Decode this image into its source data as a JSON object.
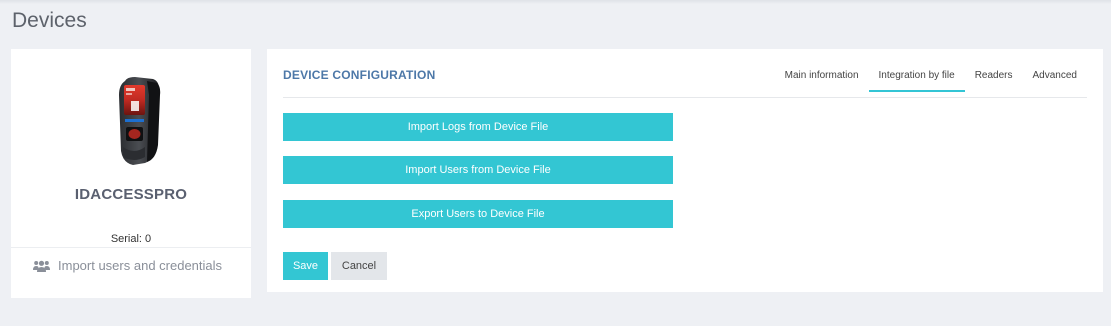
{
  "page": {
    "title": "Devices"
  },
  "device": {
    "name": "IDACCESSPRO",
    "serial": "Serial: 0",
    "import_link": "Import users and credentials",
    "image_icon": "fingerprint-terminal",
    "link_icon": "users-icon"
  },
  "config": {
    "title": "DEVICE CONFIGURATION",
    "tabs": [
      {
        "label": "Main information",
        "active": false
      },
      {
        "label": "Integration by file",
        "active": true
      },
      {
        "label": "Readers",
        "active": false
      },
      {
        "label": "Advanced",
        "active": false
      }
    ],
    "actions": {
      "import_logs": "Import Logs from Device File",
      "import_users": "Import Users from Device File",
      "export_users": "Export Users to Device File"
    },
    "save_label": "Save",
    "cancel_label": "Cancel"
  },
  "colors": {
    "accent": "#33c6d3",
    "title_blue": "#4d78a8",
    "background": "#eef0f4"
  }
}
